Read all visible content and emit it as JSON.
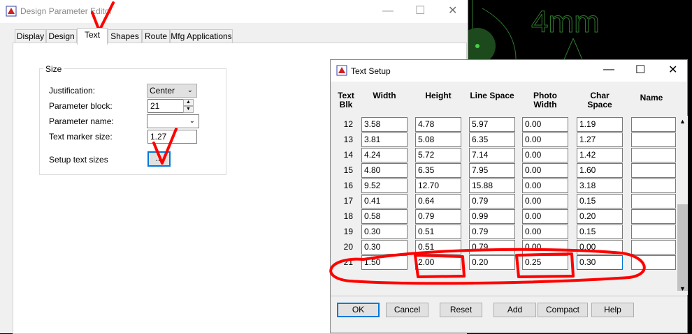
{
  "background": {
    "label_4mm": "4mm"
  },
  "editor": {
    "title": "Design Parameter Editor",
    "tabs": [
      "Display",
      "Design",
      "Text",
      "Shapes",
      "Route",
      "Mfg Applications"
    ],
    "active_tab": "Text",
    "group_title": "Size",
    "justification_label": "Justification:",
    "justification_value": "Center",
    "parameter_block_label": "Parameter block:",
    "parameter_block_value": "21",
    "parameter_name_label": "Parameter name:",
    "parameter_name_value": "",
    "text_marker_label": "Text marker size:",
    "text_marker_value": "1.27",
    "setup_text_label": "Setup text sizes",
    "setup_button_label": "..."
  },
  "text_setup": {
    "title": "Text Setup",
    "columns": [
      "Text Blk",
      "Width",
      "Height",
      "Line Space",
      "Photo Width",
      "Char Space",
      "Name"
    ],
    "rows": [
      {
        "blk": "12",
        "width": "3.58",
        "height": "4.78",
        "line": "5.97",
        "photo": "0.00",
        "char": "1.19",
        "name": ""
      },
      {
        "blk": "13",
        "width": "3.81",
        "height": "5.08",
        "line": "6.35",
        "photo": "0.00",
        "char": "1.27",
        "name": ""
      },
      {
        "blk": "14",
        "width": "4.24",
        "height": "5.72",
        "line": "7.14",
        "photo": "0.00",
        "char": "1.42",
        "name": ""
      },
      {
        "blk": "15",
        "width": "4.80",
        "height": "6.35",
        "line": "7.95",
        "photo": "0.00",
        "char": "1.60",
        "name": ""
      },
      {
        "blk": "16",
        "width": "9.52",
        "height": "12.70",
        "line": "15.88",
        "photo": "0.00",
        "char": "3.18",
        "name": ""
      },
      {
        "blk": "17",
        "width": "0.41",
        "height": "0.64",
        "line": "0.79",
        "photo": "0.00",
        "char": "0.15",
        "name": ""
      },
      {
        "blk": "18",
        "width": "0.58",
        "height": "0.79",
        "line": "0.99",
        "photo": "0.00",
        "char": "0.20",
        "name": ""
      },
      {
        "blk": "19",
        "width": "0.30",
        "height": "0.51",
        "line": "0.79",
        "photo": "0.00",
        "char": "0.15",
        "name": ""
      },
      {
        "blk": "20",
        "width": "0.30",
        "height": "0.51",
        "line": "0.79",
        "photo": "0.00",
        "char": "0.00",
        "name": ""
      },
      {
        "blk": "21",
        "width": "1.50",
        "height": "2.00",
        "line": "0.20",
        "photo": "0.25",
        "char": "0.30",
        "name": ""
      }
    ],
    "buttons": [
      "OK",
      "Cancel",
      "Reset",
      "Add",
      "Compact",
      "Help"
    ]
  },
  "colors": {
    "annotation": "#ff0000",
    "focus": "#0078d7",
    "cad_green": "#2a7a2a"
  },
  "icons": {
    "app": "app-logo-icon",
    "minimize": "minimize-icon",
    "maximize": "maximize-icon",
    "close": "close-icon"
  }
}
